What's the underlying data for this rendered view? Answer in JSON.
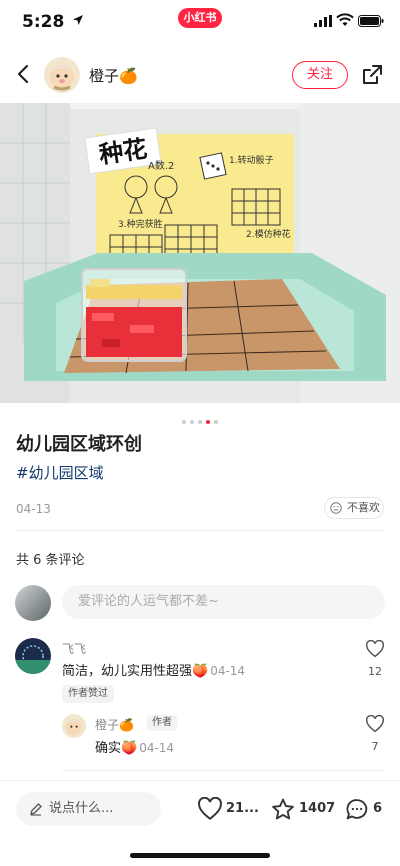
{
  "status_bar": {
    "time": "5:28",
    "brand": "小红书"
  },
  "header": {
    "author": "橙子🍊",
    "follow_label": "关注"
  },
  "photo": {
    "board_title": "种花",
    "step1": "1.转动骰子",
    "step2": "2.模仿种花",
    "step3": "3.种完获胜",
    "players": "A数.2"
  },
  "carousel": {
    "total": 5,
    "active_index": 3
  },
  "post": {
    "title": "幼儿园区域环创",
    "tag": "#幼儿园区域",
    "date": "04-13",
    "dislike_label": "不喜欢"
  },
  "comments": {
    "count_label": "共 6 条评论",
    "input_placeholder": "爱评论的人运气都不差~",
    "items": [
      {
        "name": "飞飞",
        "text": "简洁，幼儿实用性超强🍑",
        "date": "04-14",
        "likes": "12",
        "badge": "作者赞过"
      }
    ],
    "reply": {
      "name": "橙子🍊",
      "role": "作者",
      "text": "确实🍑",
      "date": "04-14",
      "likes": "7"
    }
  },
  "bottom_bar": {
    "say_placeholder": "说点什么...",
    "likes": "21...",
    "stars": "1407",
    "comments": "6"
  },
  "colors": {
    "accent": "#ff2442",
    "tag": "#13386c",
    "tray": "#9fd9c6",
    "card": "#f9ea8f"
  }
}
